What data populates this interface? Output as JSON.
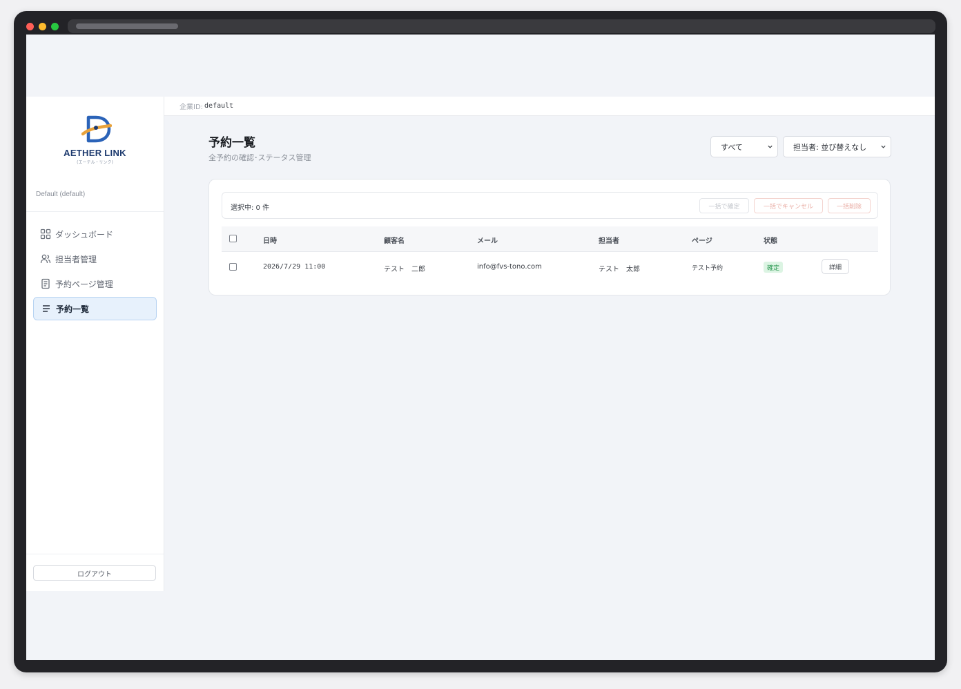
{
  "brand": {
    "name": "AETHER LINK",
    "subtitle": "(エーテル・リンク)",
    "accent_color": "#1d3a6e",
    "swoosh_color": "#e8a23b"
  },
  "sidebar": {
    "tenant": "Default (default)",
    "items": [
      {
        "label": "ダッシュボード",
        "icon": "grid-icon"
      },
      {
        "label": "担当者管理",
        "icon": "users-icon"
      },
      {
        "label": "予約ページ管理",
        "icon": "document-icon"
      },
      {
        "label": "予約一覧",
        "icon": "list-icon",
        "active": true
      }
    ],
    "logout_label": "ログアウト"
  },
  "topbar": {
    "company_label": "企業ID:",
    "company_id": "default"
  },
  "page": {
    "title": "予約一覧",
    "subtitle": "全予約の確認･ステータス管理"
  },
  "filters": {
    "status": "すべて",
    "sort": "担当者: 並び替えなし"
  },
  "bulk": {
    "selected_text": "選択中: 0 件",
    "confirm_label": "一括で確定",
    "cancel_label": "一括でキャンセル",
    "delete_label": "一括削除"
  },
  "table": {
    "headers": [
      "日時",
      "顧客名",
      "メール",
      "担当者",
      "ページ",
      "状態"
    ],
    "rows": [
      {
        "datetime": "2026/7/29 11:00",
        "customer": "テスト　二郎",
        "email": "info@fvs-tono.com",
        "staff": "テスト　太郎",
        "page": "テスト予約",
        "status": "確定",
        "action": "詳細"
      }
    ]
  },
  "status_colors": {
    "confirmed_bg": "#dcf4e3",
    "confirmed_text": "#2f9a55"
  }
}
